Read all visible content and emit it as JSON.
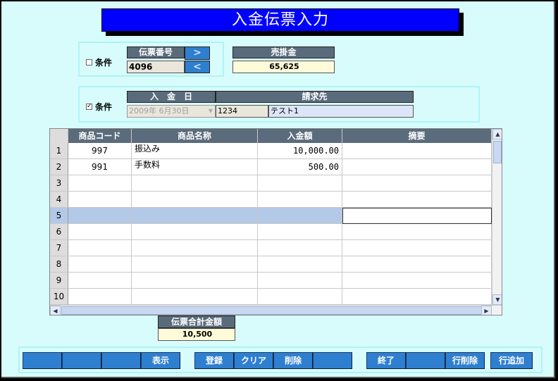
{
  "title": "入金伝票入力",
  "voucher": {
    "cond_label": "条件",
    "cond_checked": false,
    "number_header": "伝票番号",
    "number_value": "4096",
    "next_label": ">",
    "prev_label": "<",
    "sales_header": "売掛金",
    "sales_value": "65,625"
  },
  "deposit": {
    "cond_label": "条件",
    "cond_checked": true,
    "date_header": "入　金　日",
    "date_value": "2009年 6月30日",
    "billing_header": "請求先",
    "billing_code": "1234",
    "billing_name": "テスト1"
  },
  "grid": {
    "columns": [
      "商品コード",
      "商品名称",
      "入金額",
      "摘要"
    ],
    "rows": [
      {
        "no": "1",
        "code": "997",
        "name": "振込み",
        "amount": "10,000.00",
        "memo": ""
      },
      {
        "no": "2",
        "code": "991",
        "name": "手数料",
        "amount": "500.00",
        "memo": ""
      },
      {
        "no": "3",
        "code": "",
        "name": "",
        "amount": "",
        "memo": ""
      },
      {
        "no": "4",
        "code": "",
        "name": "",
        "amount": "",
        "memo": ""
      },
      {
        "no": "5",
        "code": "",
        "name": "",
        "amount": "",
        "memo": ""
      },
      {
        "no": "6",
        "code": "",
        "name": "",
        "amount": "",
        "memo": ""
      },
      {
        "no": "7",
        "code": "",
        "name": "",
        "amount": "",
        "memo": ""
      },
      {
        "no": "8",
        "code": "",
        "name": "",
        "amount": "",
        "memo": ""
      },
      {
        "no": "9",
        "code": "",
        "name": "",
        "amount": "",
        "memo": ""
      },
      {
        "no": "10",
        "code": "",
        "name": "",
        "amount": "",
        "memo": ""
      }
    ],
    "selected_row": 5
  },
  "total": {
    "header": "伝票合計金額",
    "value": "10,500"
  },
  "buttons": [
    "",
    "",
    "",
    "表示",
    "登録",
    "クリア",
    "削除",
    "",
    "終了",
    "",
    "行削除",
    "行追加"
  ],
  "colors": {
    "background": "#d8fcfc",
    "title_bg": "#0000ff",
    "header_bg": "#5a6b7c",
    "button_bg": "#2f7fd0",
    "value_bg": "#fffbd9",
    "readonly_bg": "#eae6dc",
    "selected_row": "#b4c8e8"
  }
}
